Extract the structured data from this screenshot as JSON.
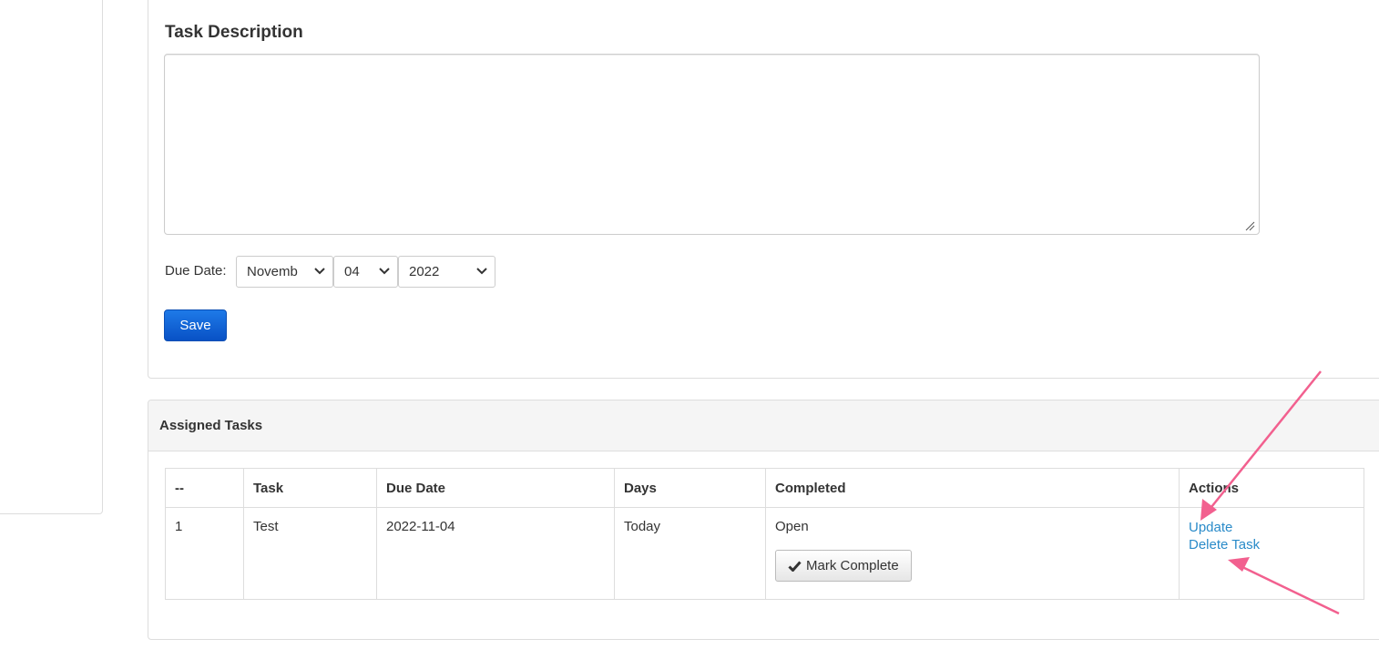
{
  "form": {
    "description_label": "Task Description",
    "description_value": "",
    "due_label": "Due Date:",
    "month_value": "Novemb",
    "day_value": "04",
    "year_value": "2022",
    "save_label": "Save"
  },
  "tasks_panel": {
    "heading": "Assigned Tasks",
    "columns": [
      "--",
      "Task",
      "Due Date",
      "Days",
      "Completed",
      "Actions"
    ],
    "rows": [
      {
        "index": "1",
        "task": "Test",
        "due_date": "2022-11-04",
        "days": "Today",
        "completed": "Open",
        "mark_complete_label": "Mark Complete",
        "update_label": "Update",
        "delete_label": "Delete Task"
      }
    ]
  },
  "icons": {
    "check": "check-icon",
    "chevron": "chevron-down-icon",
    "grip": "resize-grip-icon"
  },
  "colors": {
    "primary": "#0851c5",
    "link": "#2a8bc9",
    "annotation": "#f2608f",
    "panel_heading_bg": "#f5f5f5"
  }
}
